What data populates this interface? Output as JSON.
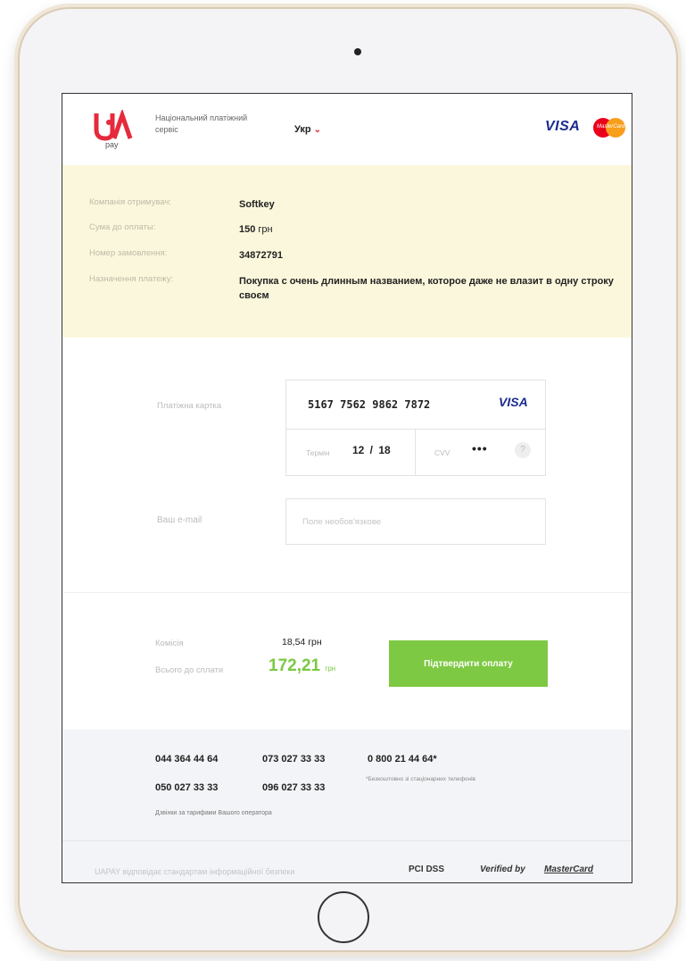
{
  "header": {
    "logo_sub": "pay",
    "service_text": "Національний платіжний сервіс",
    "lang": "Укр",
    "visa": "VISA",
    "mastercard_small": "MasterCard"
  },
  "order": {
    "rows": [
      {
        "label": "Компанія отримувач:",
        "value": "Softkey",
        "unit": ""
      },
      {
        "label": "Сума до оплаты:",
        "value": "150",
        "unit": " грн"
      },
      {
        "label": "Номер замовлення:",
        "value": "34872791",
        "unit": ""
      },
      {
        "label": "Назначення платежу:",
        "value": "Покупка с очень длинным названием, которое даже не влазит в одну строку своєм",
        "unit": ""
      }
    ]
  },
  "card": {
    "label": "Платіжна картка",
    "number": "5167 7562 9862 7872",
    "brand": "VISA",
    "term_label": "Термін",
    "term_value": "12 / 18",
    "cvv_label": "CVV",
    "cvv_value": "•••",
    "help": "?"
  },
  "email": {
    "label": "Ваш e-mail",
    "placeholder": "Поле необов'язкове",
    "value": ""
  },
  "summary": {
    "fee_label": "Комісія",
    "fee_value": "18,54 грн",
    "total_label": "Всього до сплати",
    "total_value": "172,21",
    "total_currency": "грн",
    "confirm_button": "Підтвердити оплату"
  },
  "footer": {
    "phones": [
      "044 364 44 64",
      "073 027 33 33",
      "0 800 21 44 64*",
      "050 027 33 33",
      "096 027 33 33"
    ],
    "free_note": "*Безкоштовно зі стаціонарних телефонів",
    "tariff_note": "Дзвінки за тарифами Вашого оператора",
    "security_text": "UAPAY відповідає стандартам інформаційної безпеки",
    "badges": [
      "PCI DSS",
      "Verified by",
      "MasterCard"
    ]
  },
  "colors": {
    "accent_green": "#7ec943",
    "logo_red": "#e6293b",
    "visa_blue": "#1a2b8e",
    "info_bg": "#fbf7dc"
  }
}
